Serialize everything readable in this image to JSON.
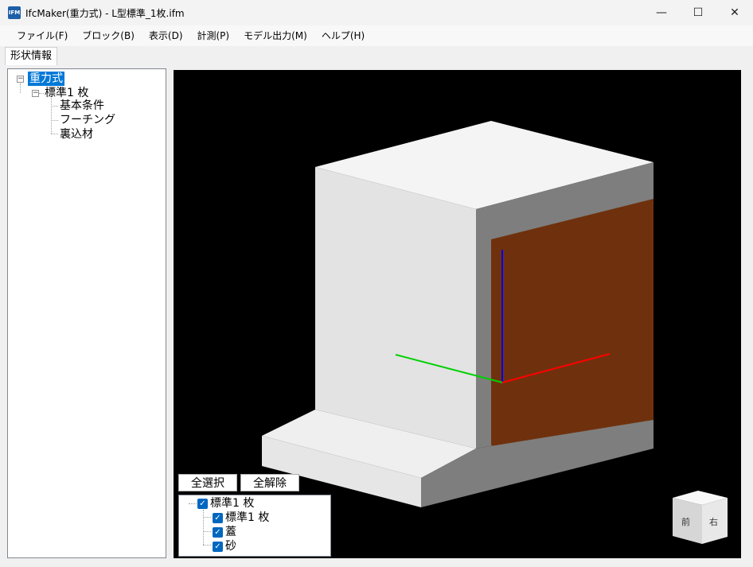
{
  "window": {
    "title": "IfcMaker(重力式) - L型標準_1枚.ifm",
    "app_icon_text": "IFM",
    "minimize_glyph": "—",
    "maximize_glyph": "☐",
    "close_glyph": "✕"
  },
  "menu": {
    "items": [
      "ファイル(F)",
      "ブロック(B)",
      "表示(D)",
      "計測(P)",
      "モデル出力(M)",
      "ヘルプ(H)"
    ]
  },
  "tabs": {
    "shape_info": "形状情報"
  },
  "tree": {
    "root": "重力式",
    "child": "標準1 枚",
    "leaves": [
      "基本条件",
      "フーチング",
      "裏込材"
    ]
  },
  "buttons": {
    "select_all": "全選択",
    "clear_all": "全解除"
  },
  "layers": {
    "root": "標準1 枚",
    "items": [
      "標準1 枚",
      "蓋",
      "砂"
    ]
  },
  "view_cube": {
    "front": "前",
    "right": "右"
  },
  "colors": {
    "selection": "#0078d7",
    "checkbox": "#0067c0",
    "backfill": "#6f310d",
    "x_axis": "#ff0000",
    "y_axis": "#00d000",
    "z_axis": "#0000ff"
  }
}
